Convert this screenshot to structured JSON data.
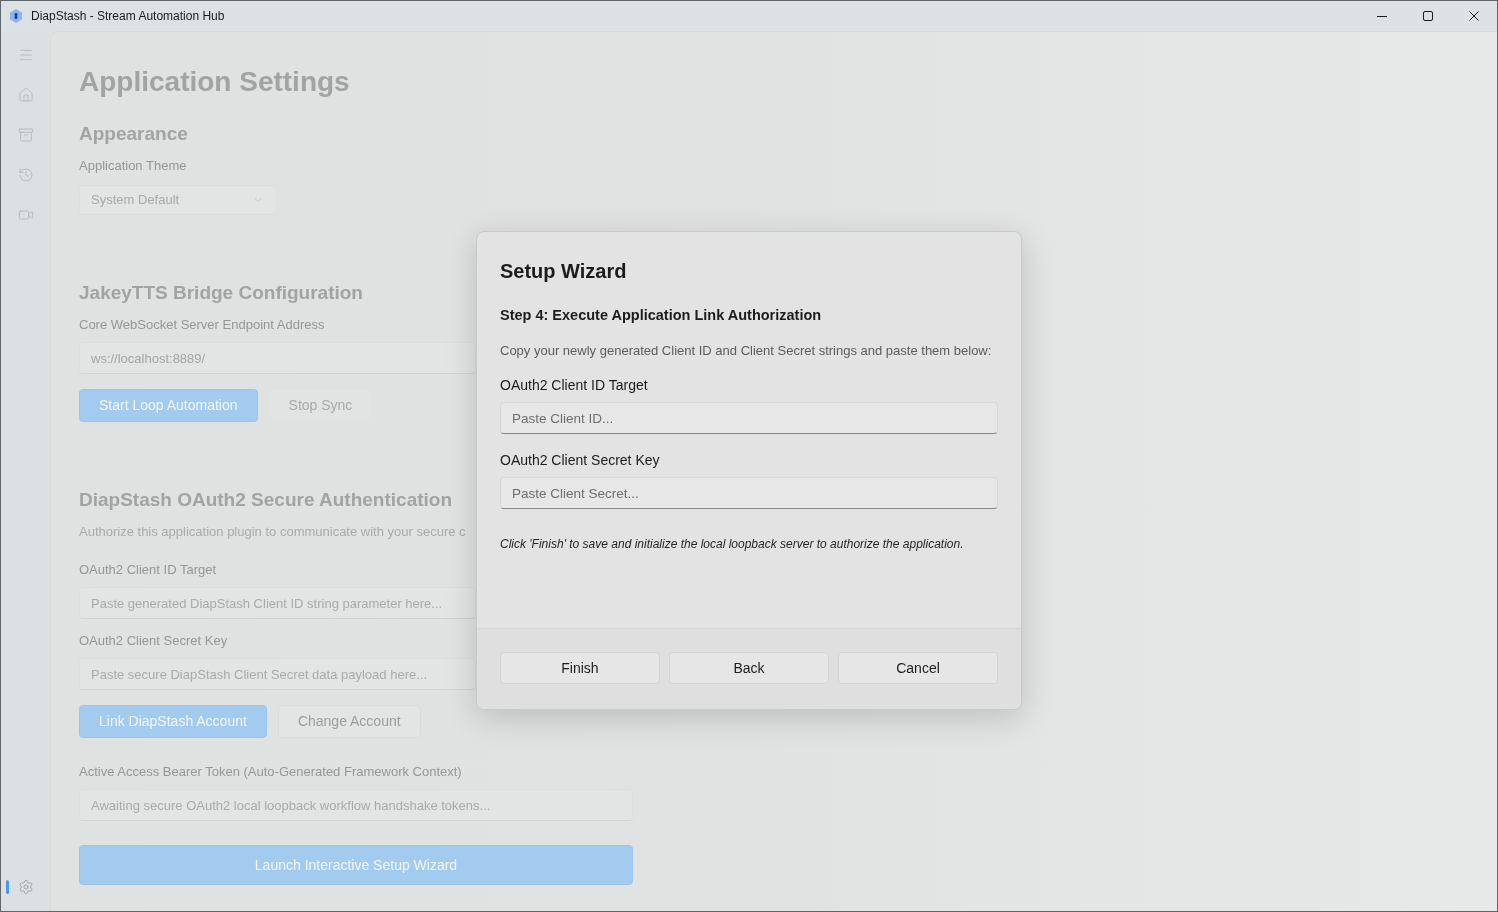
{
  "window": {
    "title": "DiapStash - Stream Automation Hub"
  },
  "sidebar": {
    "items": [
      {
        "selected": false
      },
      {
        "selected": false
      },
      {
        "selected": false
      },
      {
        "selected": false
      }
    ],
    "footer_items": [
      {
        "selected": true
      }
    ]
  },
  "page": {
    "title": "Application Settings",
    "sections": [
      {
        "heading": "Appearance",
        "items": [
          {
            "kind": "combo",
            "label": "Application Theme",
            "value": "System Default"
          }
        ]
      },
      {
        "heading": "JakeyTTS Bridge Configuration",
        "items": [
          {
            "kind": "text_field",
            "label": "Core WebSocket Server Endpoint Address",
            "value": "ws://localhost:8889/"
          },
          {
            "kind": "button_row",
            "buttons": [
              {
                "label": "Start Loop Automation",
                "accent": true,
                "disabled": false
              },
              {
                "label": "Stop Sync",
                "accent": false,
                "disabled": true
              }
            ]
          }
        ]
      },
      {
        "heading": "DiapStash OAuth2 Secure Authentication",
        "description": "Authorize this application plugin to communicate with your secure c",
        "items": [
          {
            "kind": "text_field",
            "label": "OAuth2 Client ID Target",
            "placeholder": "Paste generated DiapStash Client ID string parameter here..."
          },
          {
            "kind": "text_field",
            "label": "OAuth2 Client Secret Key",
            "placeholder": "Paste secure DiapStash Client Secret data payload here..."
          },
          {
            "kind": "button_row",
            "buttons": [
              {
                "label": "Link DiapStash Account",
                "accent": true,
                "disabled": false
              },
              {
                "label": "Change Account",
                "accent": false,
                "disabled": false
              }
            ]
          },
          {
            "kind": "text_field",
            "label": "Active Access Bearer Token (Auto-Generated Framework Context)",
            "placeholder": "Awaiting secure OAuth2 local loopback workflow handshake tokens..."
          },
          {
            "kind": "wide_button",
            "label": "Launch Interactive Setup Wizard",
            "accent": true,
            "disabled": false
          }
        ]
      }
    ]
  },
  "dialog": {
    "title": "Setup Wizard",
    "step": "Step 4: Execute Application Link Authorization",
    "instructions": "Copy your newly generated Client ID and Client Secret strings and paste them below:",
    "fields": [
      {
        "label": "OAuth2 Client ID Target",
        "placeholder": "Paste Client ID..."
      },
      {
        "label": "OAuth2 Client Secret Key",
        "placeholder": "Paste Client Secret..."
      }
    ],
    "note": "Click 'Finish' to save and initialize the local loopback server to authorize the application.",
    "buttons": [
      {
        "label": "Finish"
      },
      {
        "label": "Back"
      },
      {
        "label": "Cancel"
      }
    ]
  }
}
